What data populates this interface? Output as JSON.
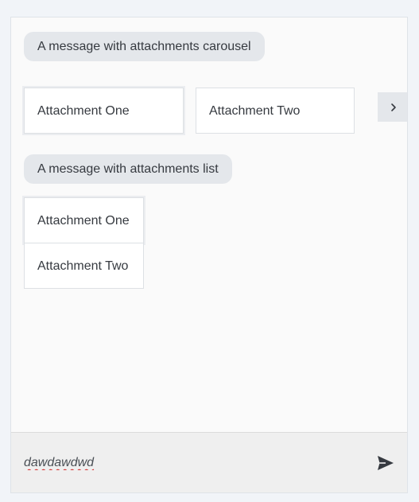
{
  "messages": [
    {
      "text": "A message with attachments carousel",
      "layout": "carousel",
      "attachments": [
        "Attachment One",
        "Attachment Two"
      ]
    },
    {
      "text": "A message with attachments list",
      "layout": "list",
      "attachments": [
        "Attachment One",
        "Attachment Two"
      ]
    }
  ],
  "carousel_next_icon": "chevron-right-icon",
  "composer": {
    "value": "dawdawdwd",
    "send_icon": "send-icon"
  },
  "colors": {
    "page_background": "#f1f4f8",
    "chat_background": "#fafafa",
    "bubble_background": "#e4e7eb",
    "composer_background": "#efefef",
    "text": "#363a40"
  }
}
